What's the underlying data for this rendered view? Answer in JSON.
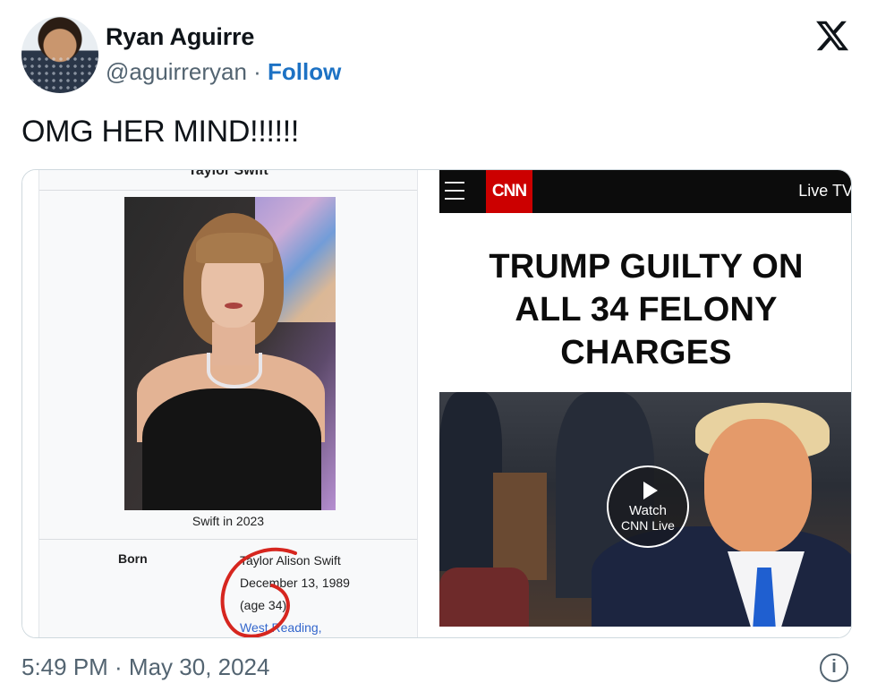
{
  "author": {
    "name": "Ryan Aguirre",
    "handle": "@aguirreryan",
    "separator": "·",
    "follow_label": "Follow"
  },
  "icons": {
    "brand": "x-logo-icon",
    "menu": "hamburger-menu-icon",
    "play": "play-icon",
    "info": "info-icon"
  },
  "tweet": {
    "text": "OMG HER MIND!!!!!!",
    "timestamp": "5:49 PM · May 30, 2024"
  },
  "wiki_panel": {
    "title": "Taylor Swift",
    "caption": "Swift in 2023",
    "born_label": "Born",
    "born_name": "Taylor Alison Swift",
    "born_date": "December 13, 1989",
    "born_age": "(age 34)",
    "born_place": "West Reading,"
  },
  "cnn_panel": {
    "logo": "CNN",
    "live_tv_label": "Live TV",
    "headline_lines": [
      "TRUMP GUILTY ON",
      "ALL 34 FELONY",
      "CHARGES"
    ],
    "watch_line1": "Watch",
    "watch_line2": "CNN Live"
  },
  "colors": {
    "follow": "#1d72c4",
    "secondary_text": "#536471",
    "cnn_red": "#cc0000",
    "annotation_red": "#d6261f",
    "wiki_link": "#3366cc"
  },
  "info_glyph": "i"
}
